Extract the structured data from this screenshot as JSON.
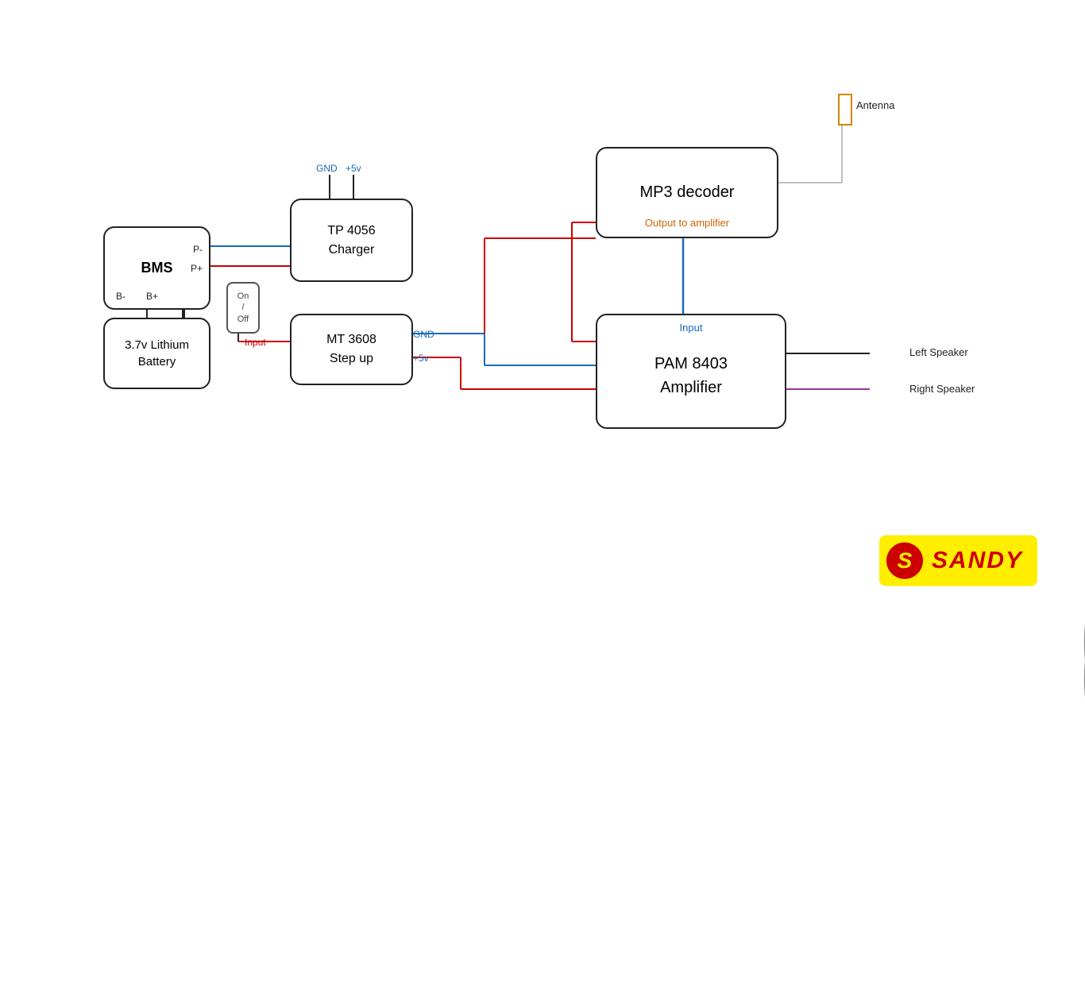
{
  "components": {
    "bms": {
      "label": "BMS",
      "sub_labels": [
        "B-",
        "B+",
        "P-",
        "P+"
      ]
    },
    "battery": {
      "label": "3.7v Lithium\nBattery"
    },
    "tp4056": {
      "label": "TP 4056\nCharger",
      "pin_labels": [
        "GND",
        "+5v"
      ]
    },
    "mt3608": {
      "label": "MT 3608\nStep up",
      "pin_labels": [
        "GND",
        "+5v",
        "Input"
      ]
    },
    "mp3decoder": {
      "label": "MP3 decoder",
      "output_label": "Output to amplifier"
    },
    "pam8403": {
      "label": "PAM 8403\nAmplifier",
      "input_label": "Input"
    },
    "switch": {
      "label": "On\n/\nOff"
    },
    "antenna": {
      "label": "Antenna"
    },
    "left_speaker": {
      "label": "Left Speaker"
    },
    "right_speaker": {
      "label": "Right Speaker"
    }
  },
  "logo": {
    "symbol": "S",
    "name": "SANDY"
  }
}
